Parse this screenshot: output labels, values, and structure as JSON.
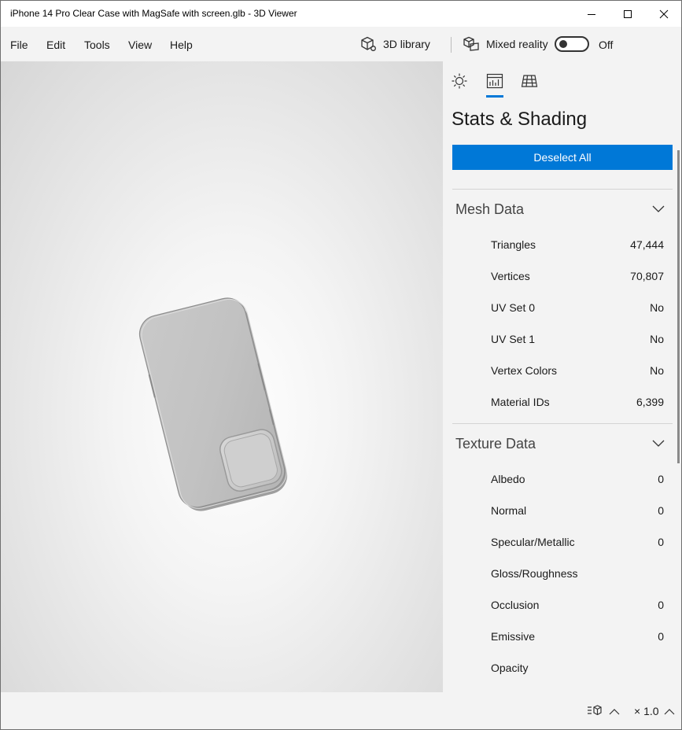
{
  "window": {
    "title": "iPhone 14 Pro Clear Case with MagSafe with screen.glb - 3D Viewer"
  },
  "menu": {
    "items": [
      "File",
      "Edit",
      "Tools",
      "View",
      "Help"
    ],
    "library_label": "3D library",
    "mixed_reality_label": "Mixed reality",
    "toggle_state": "Off"
  },
  "panel": {
    "title": "Stats & Shading",
    "deselect_label": "Deselect All",
    "active_tab": "stats",
    "mesh": {
      "heading": "Mesh Data",
      "rows": [
        {
          "label": "Triangles",
          "value": "47,444"
        },
        {
          "label": "Vertices",
          "value": "70,807"
        },
        {
          "label": "UV Set 0",
          "value": "No"
        },
        {
          "label": "UV Set 1",
          "value": "No"
        },
        {
          "label": "Vertex Colors",
          "value": "No"
        },
        {
          "label": "Material IDs",
          "value": "6,399"
        }
      ]
    },
    "texture": {
      "heading": "Texture Data",
      "rows": [
        {
          "label": "Albedo",
          "value": "0"
        },
        {
          "label": "Normal",
          "value": "0"
        },
        {
          "label": "Specular/Metallic",
          "value": "0"
        },
        {
          "label": "Gloss/Roughness",
          "value": ""
        },
        {
          "label": "Occlusion",
          "value": "0"
        },
        {
          "label": "Emissive",
          "value": "0"
        },
        {
          "label": "Opacity",
          "value": ""
        }
      ]
    }
  },
  "status": {
    "zoom": "× 1.0"
  },
  "colors": {
    "accent": "#0078d7",
    "panel_bg": "#f3f3f3"
  }
}
